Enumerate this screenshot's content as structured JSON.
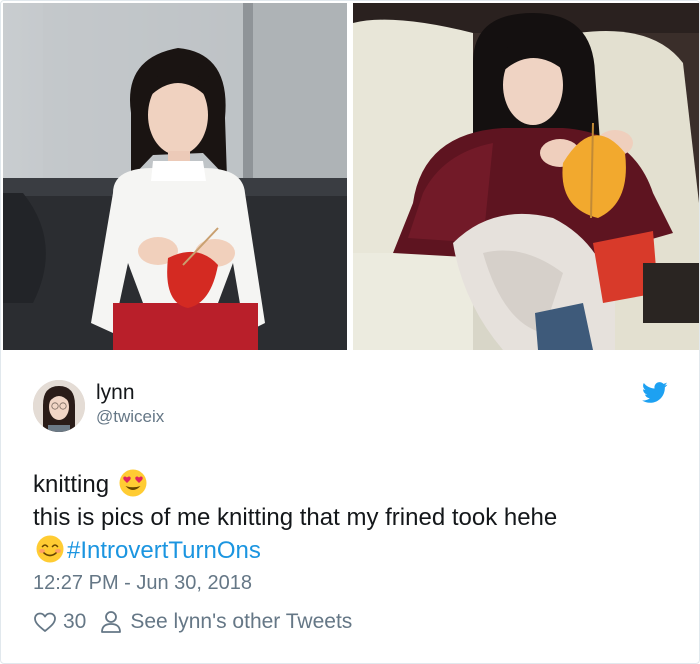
{
  "tweet": {
    "user": {
      "display_name": "lynn",
      "handle": "@twiceix"
    },
    "text": {
      "line1": "knitting",
      "line2": "this is pics of me knitting that my frined took hehe",
      "hashtag": "#IntrovertTurnOns",
      "emojis": [
        "heart-eyes-emoji",
        "smiling-emoji"
      ]
    },
    "timestamp": "12:27 PM - Jun 30, 2018",
    "likes": "30",
    "other_tweets_label": "See lynn's other Tweets"
  },
  "colors": {
    "link": "#1b95e0",
    "secondary_text": "#657786",
    "primary_text": "#14171a",
    "twitter_blue": "#1da1f2",
    "border": "#e1e8ed"
  },
  "icons": {
    "brand": "twitter-bird-icon",
    "like": "heart-outline-icon",
    "profile": "person-outline-icon"
  }
}
